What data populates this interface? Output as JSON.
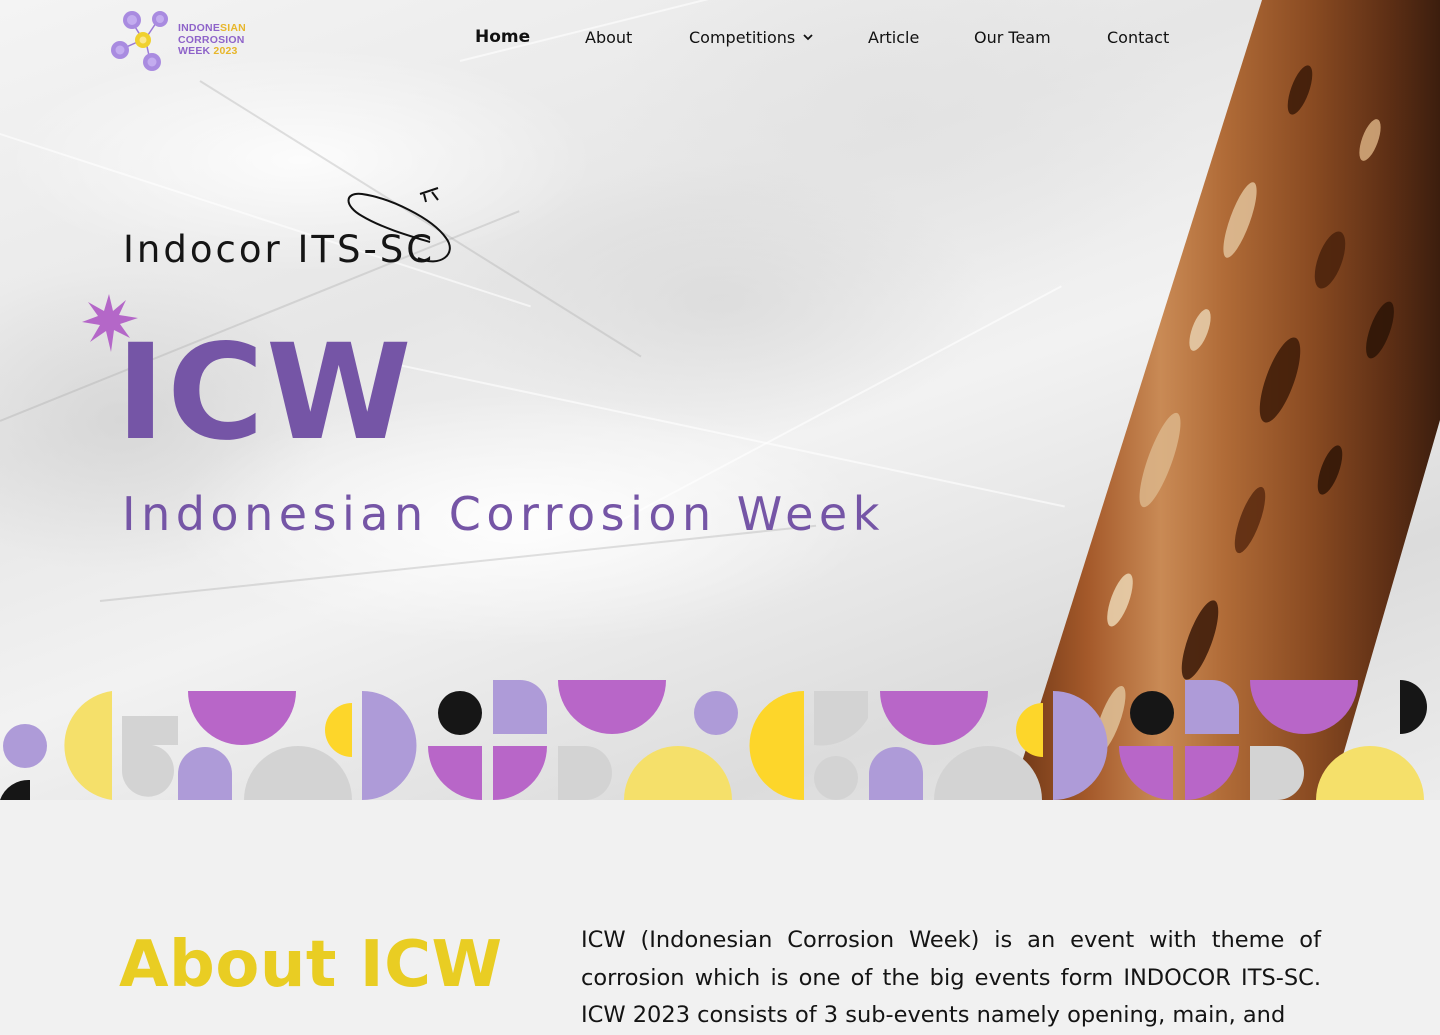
{
  "logo": {
    "line1_a": "INDONE",
    "line1_b": "SIAN",
    "line2": "CORROSION",
    "line3_a": "WEEK ",
    "line3_b": "2023",
    "colors": {
      "purple": "#8e63c9",
      "yellow": "#e7b62b"
    }
  },
  "nav": {
    "items": [
      {
        "label": "Home",
        "active": true
      },
      {
        "label": "About"
      },
      {
        "label": "Competitions",
        "icon": "chevron-down-icon"
      },
      {
        "label": "Article"
      },
      {
        "label": "Our Team"
      },
      {
        "label": "Contact"
      }
    ]
  },
  "hero": {
    "kicker": "Indocor ITS-SC",
    "title": "ICW",
    "subtitle": "Indonesian Corrosion Week",
    "icons": [
      "orbit-doodle-icon",
      "sparkle-star-icon"
    ],
    "background": "crumpled paper with rusted metal pole",
    "colors": {
      "title": "#7555a6",
      "star": "#b467c8"
    }
  },
  "pattern": {
    "colors": {
      "yellow": "#f5e06a",
      "gold": "#fdd62a",
      "lavender": "#ae9bd8",
      "magenta": "#b866c8",
      "grey": "#d3d3d3",
      "black": "#161616"
    }
  },
  "about": {
    "title": "About ICW",
    "paragraph": "ICW (Indonesian Corrosion Week) is an event with theme of corrosion which is one of the big events form INDOCOR ITS-SC. ICW 2023 consists of 3 sub-events namely opening, main, and",
    "colors": {
      "title": "#e9cd23"
    }
  }
}
